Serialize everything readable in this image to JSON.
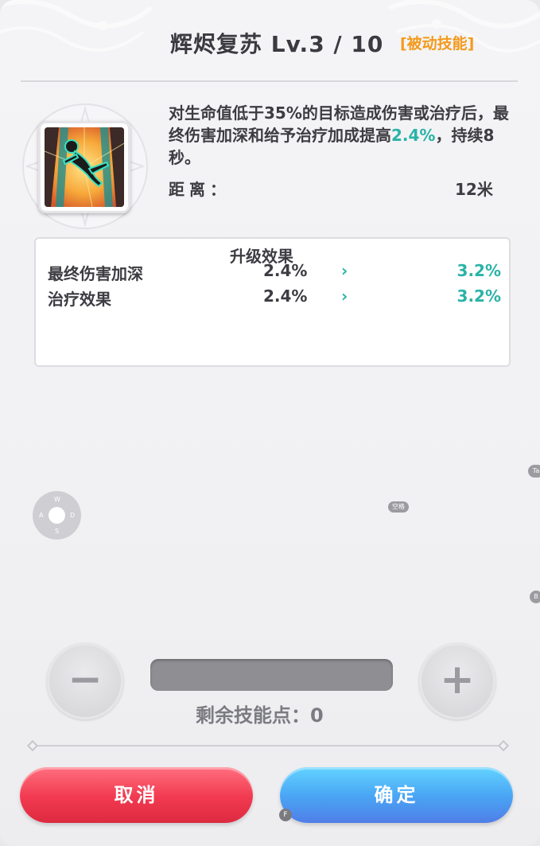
{
  "header": {
    "title": "辉烬复苏 Lv.3 / 10",
    "skill_type": "[被动技能]"
  },
  "skill": {
    "icon": "falling-figure-skill-icon",
    "description_part1": "对生命值低于35%的目标造成伤害或治疗后，最终伤害加深和给予治疗加成提高",
    "description_highlight": "2.4%",
    "description_part2": "，持续8秒。",
    "range_label": "距离：",
    "range_value": "12米"
  },
  "upgrade": {
    "title": "升级效果",
    "rows": [
      {
        "name": "最终伤害加深",
        "current": "2.4%",
        "arrow": "›",
        "next": "3.2%"
      },
      {
        "name": "治疗效果",
        "current": "2.4%",
        "arrow": "›",
        "next": "3.2%"
      }
    ]
  },
  "controls": {
    "minus_label": "−",
    "plus_label": "+",
    "remaining_points": "剩余技能点：0"
  },
  "hints": {
    "wasd": {
      "w": "W",
      "a": "A",
      "s": "S",
      "d": "D"
    },
    "space": "空格",
    "tab": "Ta",
    "b": "B",
    "f": "F"
  },
  "footer": {
    "cancel_label": "取消",
    "confirm_label": "确定"
  },
  "colors": {
    "accent_teal": "#2ab3a7",
    "skill_type_orange": "#f39a1c",
    "cancel_red": "#f1394f",
    "confirm_blue": "#4aa7f5"
  }
}
